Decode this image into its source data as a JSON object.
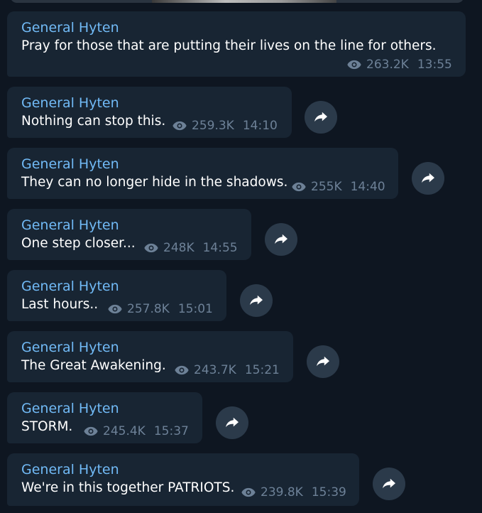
{
  "messages": [
    {
      "sender": "General Hyten",
      "text": "Pray for those that are putting their lives on the line for others.",
      "views": "263.2K",
      "time": "13:55",
      "share_icon": "share-icon"
    },
    {
      "sender": "General Hyten",
      "text": "Nothing can stop this.",
      "views": "259.3K",
      "time": "14:10",
      "share_icon": "share-icon"
    },
    {
      "sender": "General Hyten",
      "text": "They can no longer hide in the shadows.",
      "views": "255K",
      "time": "14:40",
      "share_icon": "share-icon"
    },
    {
      "sender": "General Hyten",
      "text": "One step closer...",
      "views": "248K",
      "time": "14:55",
      "share_icon": "share-icon"
    },
    {
      "sender": "General Hyten",
      "text": "Last hours..",
      "views": "257.8K",
      "time": "15:01",
      "share_icon": "share-icon"
    },
    {
      "sender": "General Hyten",
      "text": "The Great Awakening.",
      "views": "243.7K",
      "time": "15:21",
      "share_icon": "share-icon"
    },
    {
      "sender": "General Hyten",
      "text": "STORM.",
      "views": "245.4K",
      "time": "15:37",
      "share_icon": "share-icon"
    },
    {
      "sender": "General Hyten",
      "text": "We're in this together PATRIOTS.",
      "views": "239.8K",
      "time": "15:39",
      "share_icon": "share-icon"
    }
  ],
  "colors": {
    "background": "#0e1621",
    "bubble": "#182533",
    "sender": "#71baf6",
    "text": "#ffffff",
    "meta": "#6d8197",
    "share_button": "#2b3a4a"
  },
  "icons": {
    "views": "eye-icon",
    "share": "share-arrow-icon"
  }
}
